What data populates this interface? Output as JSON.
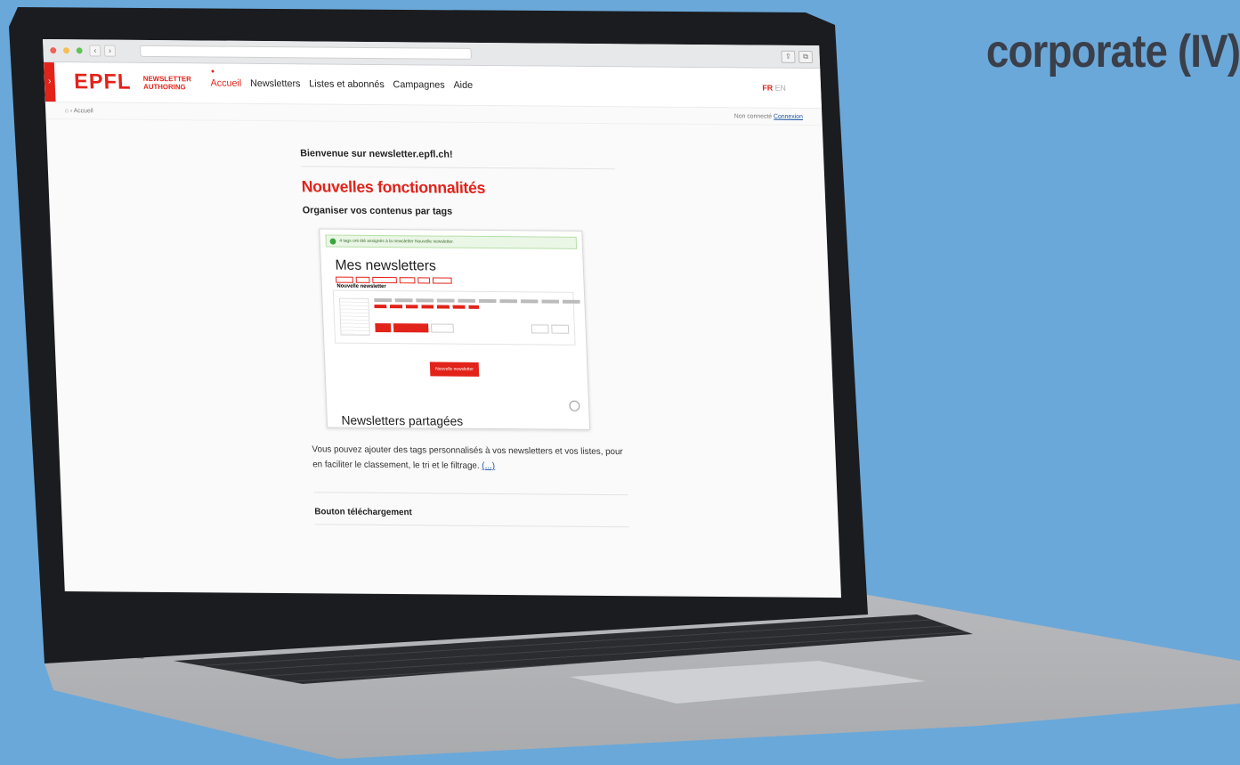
{
  "headline": "corporate (IV)",
  "browser": {
    "nav_back": "‹",
    "nav_forward": "›",
    "url": ""
  },
  "site": {
    "logo": "EPFL",
    "logo_sub_line1": "NEWSLETTER",
    "logo_sub_line2": "AUTHORING",
    "nav": [
      "Accueil",
      "Newsletters",
      "Listes et abonnés",
      "Campagnes",
      "Aide"
    ],
    "lang_active": "FR",
    "lang_other": "EN",
    "breadcrumb_home_icon": "home-icon",
    "breadcrumb": "› Accueil",
    "login_text": "Non connecté",
    "login_link": "Connexion"
  },
  "main": {
    "welcome": "Bienvenue sur newsletter.epfl.ch!",
    "new_features": "Nouvelles fonctionnalités",
    "section1_title": "Organiser vos contenus par tags",
    "screenshot": {
      "alert": "4 tags ont été assignés à la newsletter Nouvelle newsletter.",
      "title": "Mes newsletters",
      "card_title": "Nouvelle newsletter",
      "new_button": "Nouvelle newsletter",
      "shared_title": "Newsletters partagées"
    },
    "description": "Vous pouvez ajouter des tags personnalisés à vos newsletters et vos listes, pour en faciliter le classement, le tri et le filtrage.",
    "more_link": "(...)",
    "section2_title": "Bouton téléchargement"
  },
  "colors": {
    "brand_red": "#e2231a",
    "background": "#6aa8d9"
  }
}
